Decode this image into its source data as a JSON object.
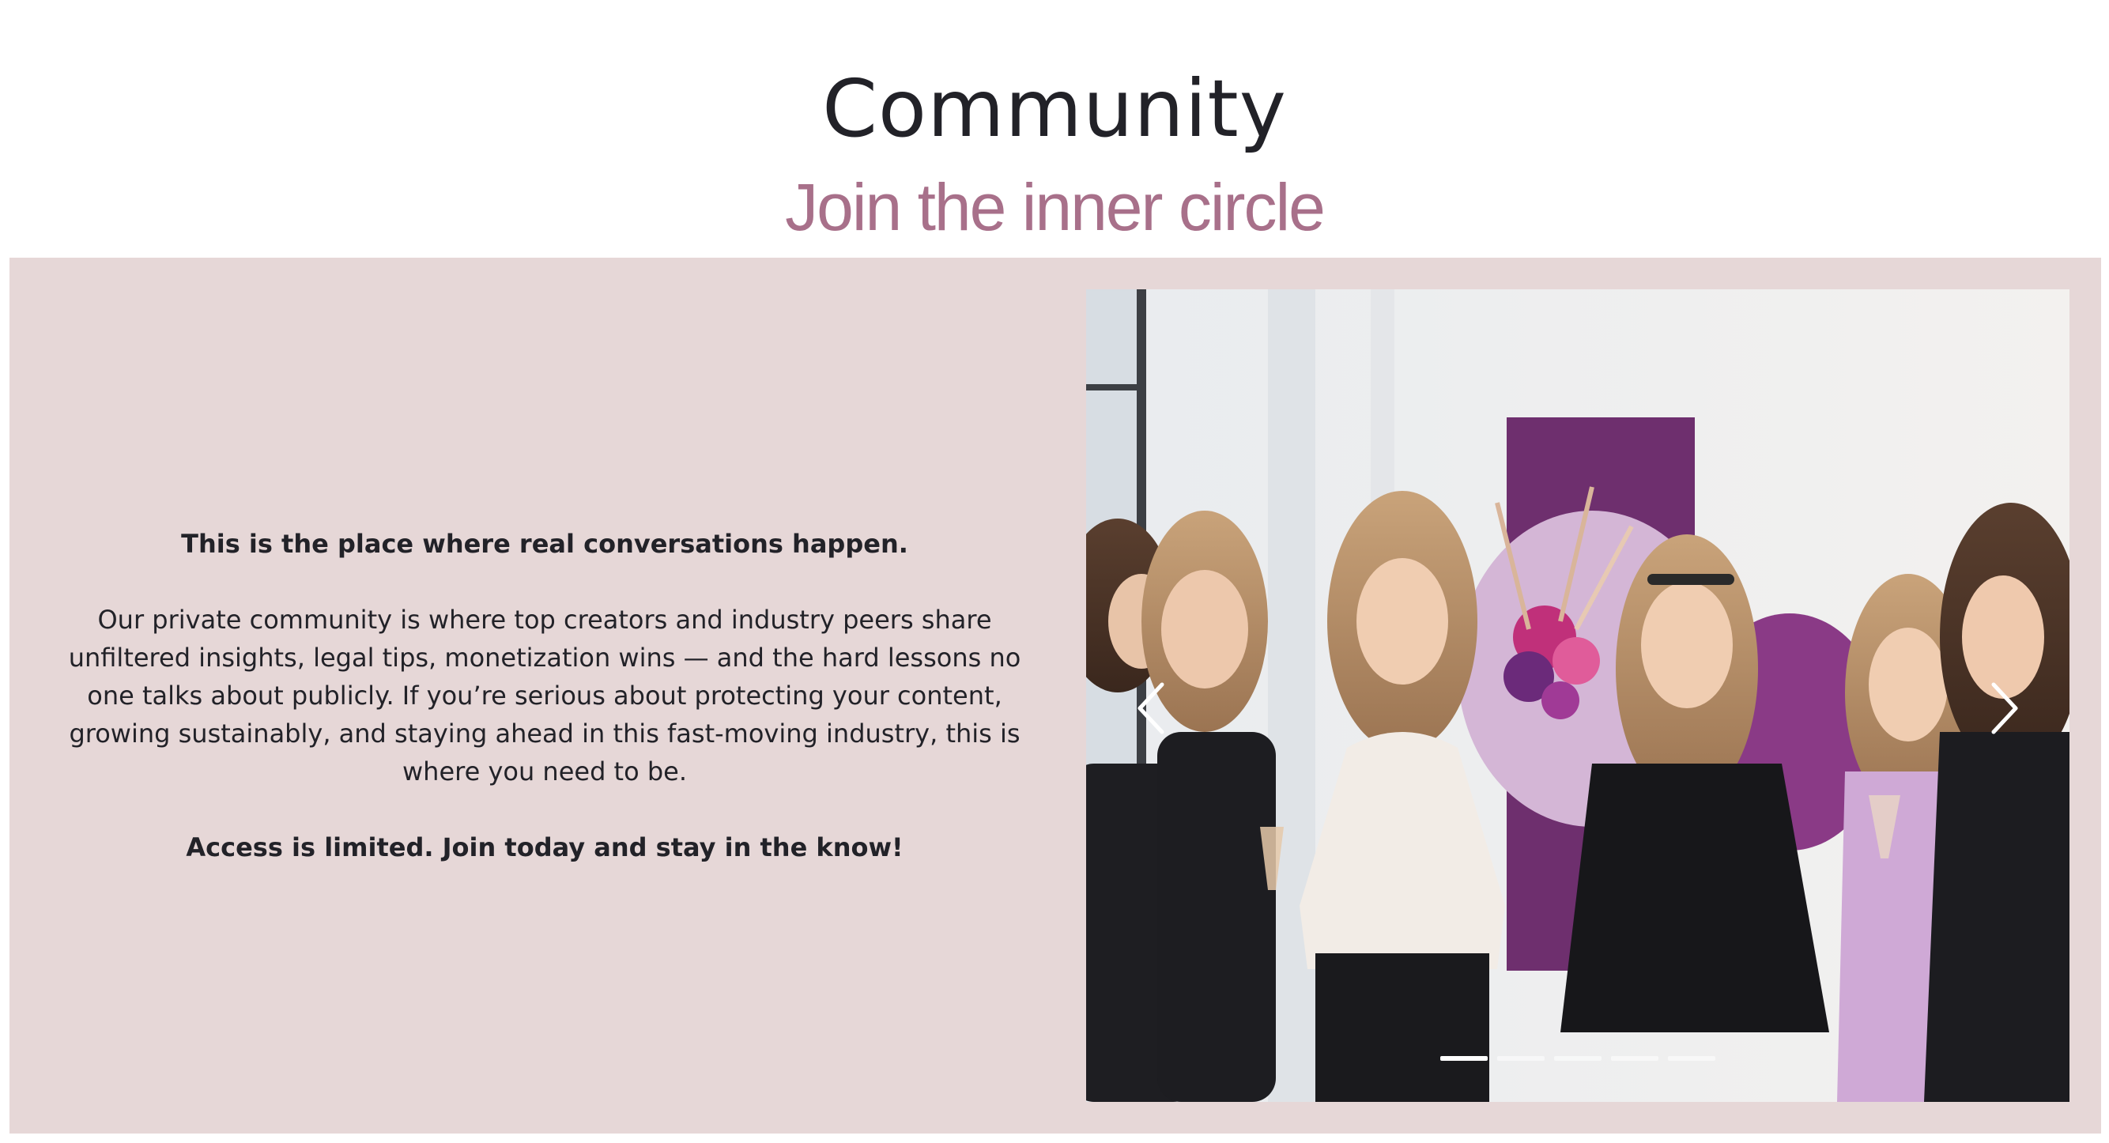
{
  "section": {
    "title": "Community",
    "subtitle": "Join the inner circle"
  },
  "copy": {
    "lead": "This is the place where real conversations happen.",
    "body": "Our private community is where top creators and industry peers share unfiltered insights, legal tips, monetization wins — and the hard lessons no one talks about publicly. If you’re serious about protecting your content, growing sustainably, and staying ahead in this fast-moving industry, this is where you need to be.",
    "cta": "Access is limited. Join today and stay in the know!"
  },
  "carousel": {
    "slide_count": 5,
    "active_index": 0,
    "prev_icon": "chevron-left-icon",
    "next_icon": "chevron-right-icon"
  },
  "colors": {
    "band_bg": "#e6d7d7",
    "subtitle": "#a8708a",
    "text": "#222228"
  }
}
